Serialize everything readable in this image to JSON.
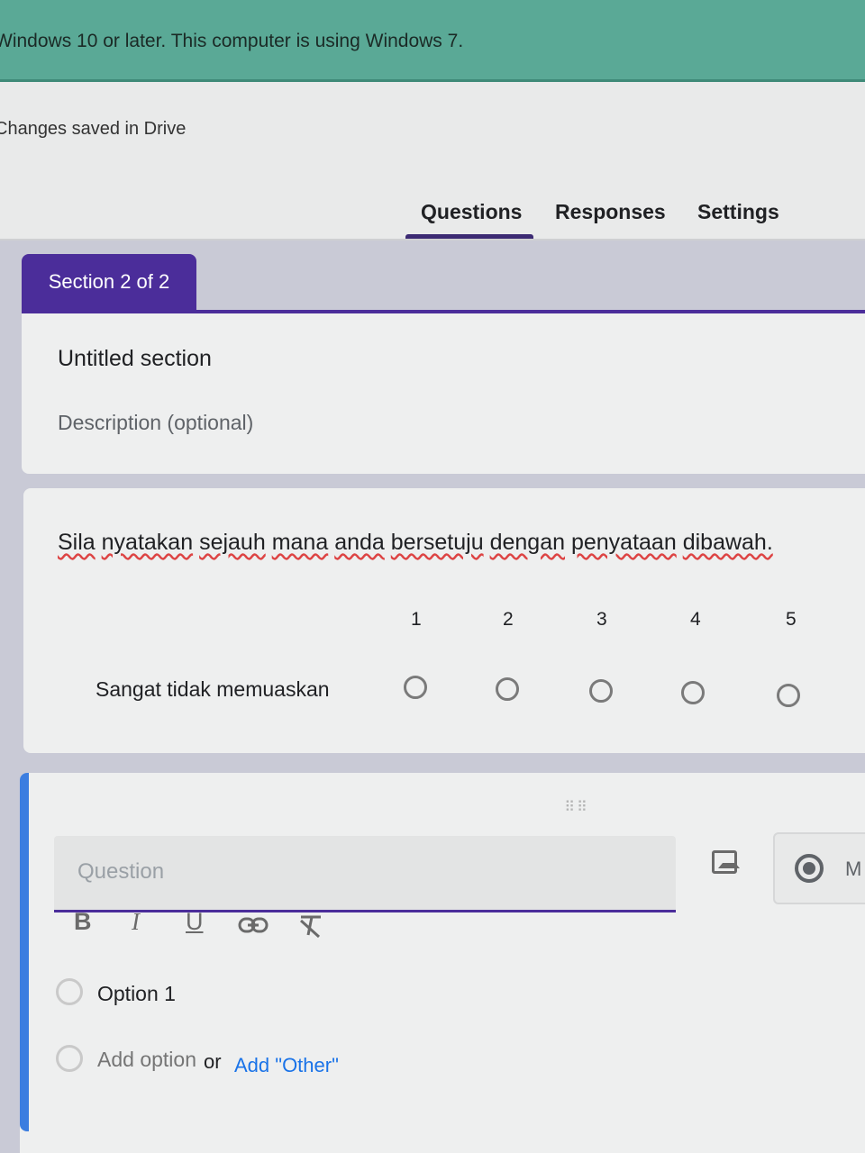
{
  "banner": {
    "text": "Windows 10 or later. This computer is using Windows 7."
  },
  "status": {
    "saved": "Changes saved in Drive"
  },
  "tabs": [
    {
      "label": "Questions",
      "active": true
    },
    {
      "label": "Responses"
    },
    {
      "label": "Settings"
    }
  ],
  "section": {
    "chip": "Section 2 of 2",
    "title": "Untitled section",
    "description_placeholder": "Description (optional)"
  },
  "scale_question": {
    "title_words": [
      "Sila",
      "nyatakan",
      "sejauh",
      "mana",
      "anda",
      "bersetuju",
      "dengan",
      "penyataan",
      "dibawah."
    ],
    "scale": [
      "1",
      "2",
      "3",
      "4",
      "5"
    ],
    "row_label": "Sangat tidak memuaskan"
  },
  "new_question": {
    "placeholder": "Question",
    "type_label": "M",
    "option1": "Option 1",
    "add_option": "Add option",
    "or": "or",
    "add_other": "Add \"Other\""
  },
  "colors": {
    "accent": "#4b2d9a",
    "banner": "#5aa996",
    "active_bar": "#3b7de0"
  }
}
